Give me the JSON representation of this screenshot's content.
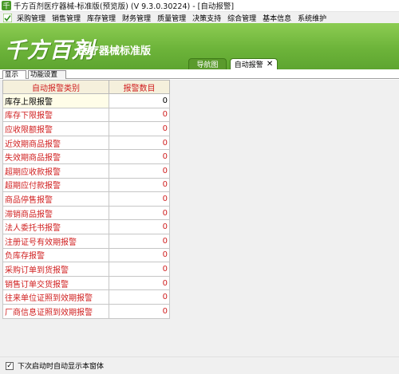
{
  "window": {
    "title": "千方百剂医疗器械-标准版(预览版) (V 9.3.0.30224) - [自动报警]"
  },
  "menubar": {
    "items": [
      "采购管理",
      "销售管理",
      "库存管理",
      "财务管理",
      "质量管理",
      "决策支持",
      "综合管理",
      "基本信息",
      "系统维护"
    ]
  },
  "banner": {
    "logo": "千方百剂",
    "product": "医疗器械标准版"
  },
  "tabs": {
    "nav_label": "导航图",
    "alarm_label": "自动报警",
    "close_glyph": "✕"
  },
  "subtabs": {
    "show_label": "显示",
    "config_label": "功能设置"
  },
  "table": {
    "col_category": "自动报警类别",
    "col_count": "报警数目",
    "rows": [
      {
        "name": "库存上限报警",
        "count": "0"
      },
      {
        "name": "库存下限报警",
        "count": "0"
      },
      {
        "name": "应收限额报警",
        "count": "0"
      },
      {
        "name": "近效期商品报警",
        "count": "0"
      },
      {
        "name": "失效期商品报警",
        "count": "0"
      },
      {
        "name": "超期应收款报警",
        "count": "0"
      },
      {
        "name": "超期应付款报警",
        "count": "0"
      },
      {
        "name": "商品停售报警",
        "count": "0"
      },
      {
        "name": "滞销商品报警",
        "count": "0"
      },
      {
        "name": "法人委托书报警",
        "count": "0"
      },
      {
        "name": "注册证号有效期报警",
        "count": "0"
      },
      {
        "name": "负库存报警",
        "count": "0"
      },
      {
        "name": "采购订单到货报警",
        "count": "0"
      },
      {
        "name": "销售订单交货报警",
        "count": "0"
      },
      {
        "name": "往来单位证照到效期报警",
        "count": "0"
      },
      {
        "name": "厂商信息证照到效期报警",
        "count": "0"
      }
    ]
  },
  "footer": {
    "checkbox_checked": true,
    "checkbox_label": "下次启动时自动显示本窗体"
  },
  "colors": {
    "brand_green": "#6db43a",
    "alarm_red": "#d02020",
    "header_bg": "#f5f0dc"
  }
}
